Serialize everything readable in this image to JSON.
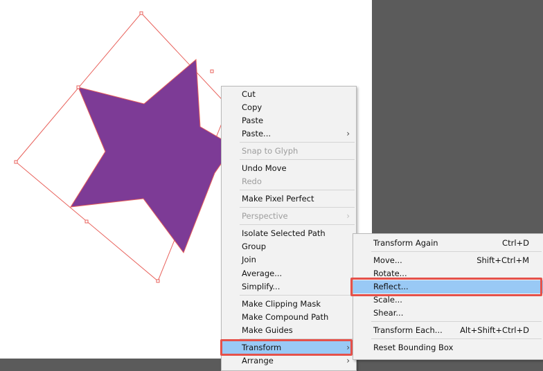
{
  "colors": {
    "star_fill": "#7d3b96",
    "selection_outline": "#e8615b",
    "highlight": "#99c9f5",
    "callout": "#e5514a"
  },
  "art": {
    "shape_icon": "star-shape"
  },
  "context_menu": {
    "cut": "Cut",
    "copy": "Copy",
    "paste": "Paste",
    "paste_submenu": "Paste...",
    "snap_to_glyph": "Snap to Glyph",
    "undo_move": "Undo Move",
    "redo": "Redo",
    "make_pixel_perfect": "Make Pixel Perfect",
    "perspective": "Perspective",
    "isolate_selected_path": "Isolate Selected Path",
    "group": "Group",
    "join": "Join",
    "average": "Average...",
    "simplify": "Simplify...",
    "make_clipping_mask": "Make Clipping Mask",
    "make_compound_path": "Make Compound Path",
    "make_guides": "Make Guides",
    "transform": "Transform",
    "arrange": "Arrange"
  },
  "transform_submenu": {
    "transform_again": {
      "label": "Transform Again",
      "shortcut": "Ctrl+D"
    },
    "move": {
      "label": "Move...",
      "shortcut": "Shift+Ctrl+M"
    },
    "rotate": {
      "label": "Rotate..."
    },
    "reflect": {
      "label": "Reflect..."
    },
    "scale": {
      "label": "Scale..."
    },
    "shear": {
      "label": "Shear..."
    },
    "transform_each": {
      "label": "Transform Each...",
      "shortcut": "Alt+Shift+Ctrl+D"
    },
    "reset_bounding_box": {
      "label": "Reset Bounding Box"
    }
  },
  "icons": {
    "submenu_arrow": "chevron-right-icon"
  }
}
